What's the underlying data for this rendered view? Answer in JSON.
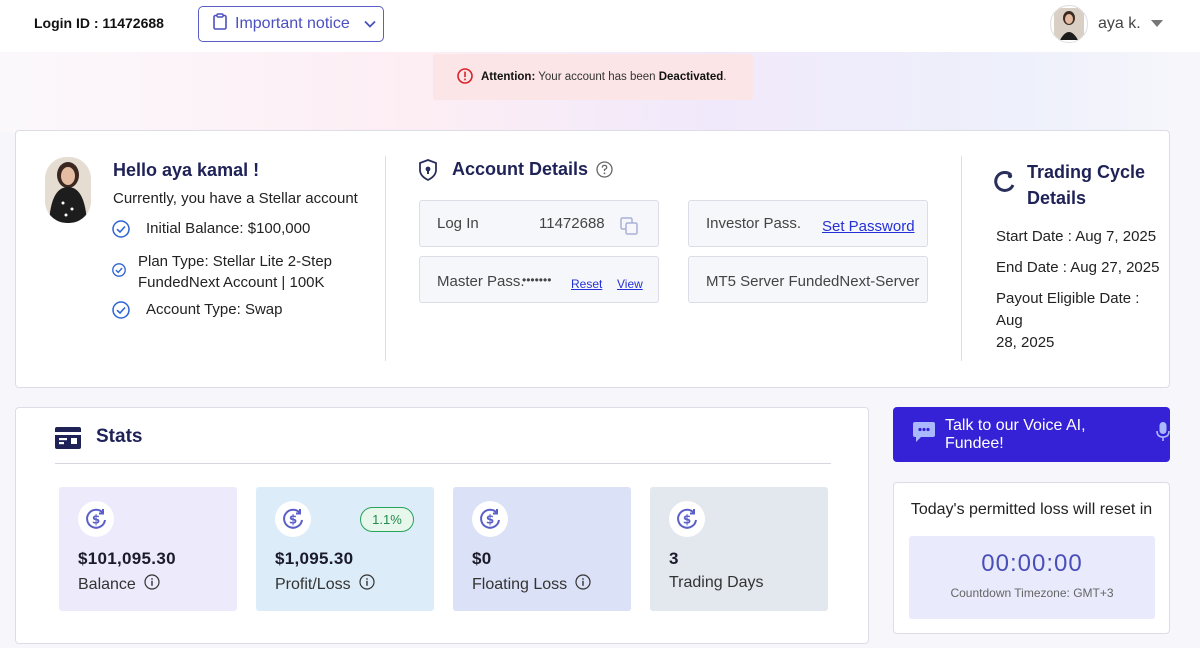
{
  "header": {
    "login_id": "Login ID : 11472688",
    "notice_label": "Important notice",
    "user_name": "aya k."
  },
  "alert": {
    "prefix": "Attention:",
    "text": "Your account has been",
    "status": "Deactivated",
    "suffix": "."
  },
  "profile": {
    "greeting": "Hello aya kamal !",
    "current": "Currently, you have a Stellar account",
    "initial_balance": "Initial Balance: $100,000",
    "plan_type_line1": "Plan Type: Stellar Lite 2-Step",
    "plan_type_line2": "FundedNext Account | 100K",
    "account_type": "Account Type: Swap"
  },
  "account_details": {
    "title": "Account Details",
    "login_label": "Log In",
    "login_value": "11472688",
    "investor_label": "Investor Pass.",
    "set_password": "Set Password",
    "master_label": "Master Pass.",
    "master_mask": "•••••••",
    "reset": "Reset",
    "view": "View",
    "server": "MT5 Server FundedNext-Server"
  },
  "trading_cycle": {
    "title_line1": "Trading Cycle",
    "title_line2": "Details",
    "start": "Start Date : Aug 7, 2025",
    "end": "End Date : Aug 27, 2025",
    "payout_line1": "Payout Eligible Date : Aug",
    "payout_line2": "28, 2025"
  },
  "stats": {
    "title": "Stats",
    "items": [
      {
        "value": "$101,095.30",
        "label": "Balance",
        "bg": "#eceafb"
      },
      {
        "value": "$1,095.30",
        "label": "Profit/Loss",
        "bg": "#dcecf8",
        "badge": "1.1%"
      },
      {
        "value": "$0",
        "label": "Floating Loss",
        "bg": "#dbe1f6"
      },
      {
        "value": "3",
        "label": "Trading Days",
        "bg": "#e3e8ef"
      }
    ]
  },
  "voice": {
    "label": "Talk to our Voice AI, Fundee!"
  },
  "timer": {
    "title": "Today's permitted loss will reset in",
    "value": "00:00:00",
    "timezone": "Countdown Timezone: GMT+3"
  },
  "colors": {
    "accent": "#3622d6",
    "title": "#1f2257",
    "link": "#2430d6",
    "alert_bg": "#fbe5e6",
    "alert_icon": "#d8232a",
    "profit_badge": "#27a35a"
  }
}
